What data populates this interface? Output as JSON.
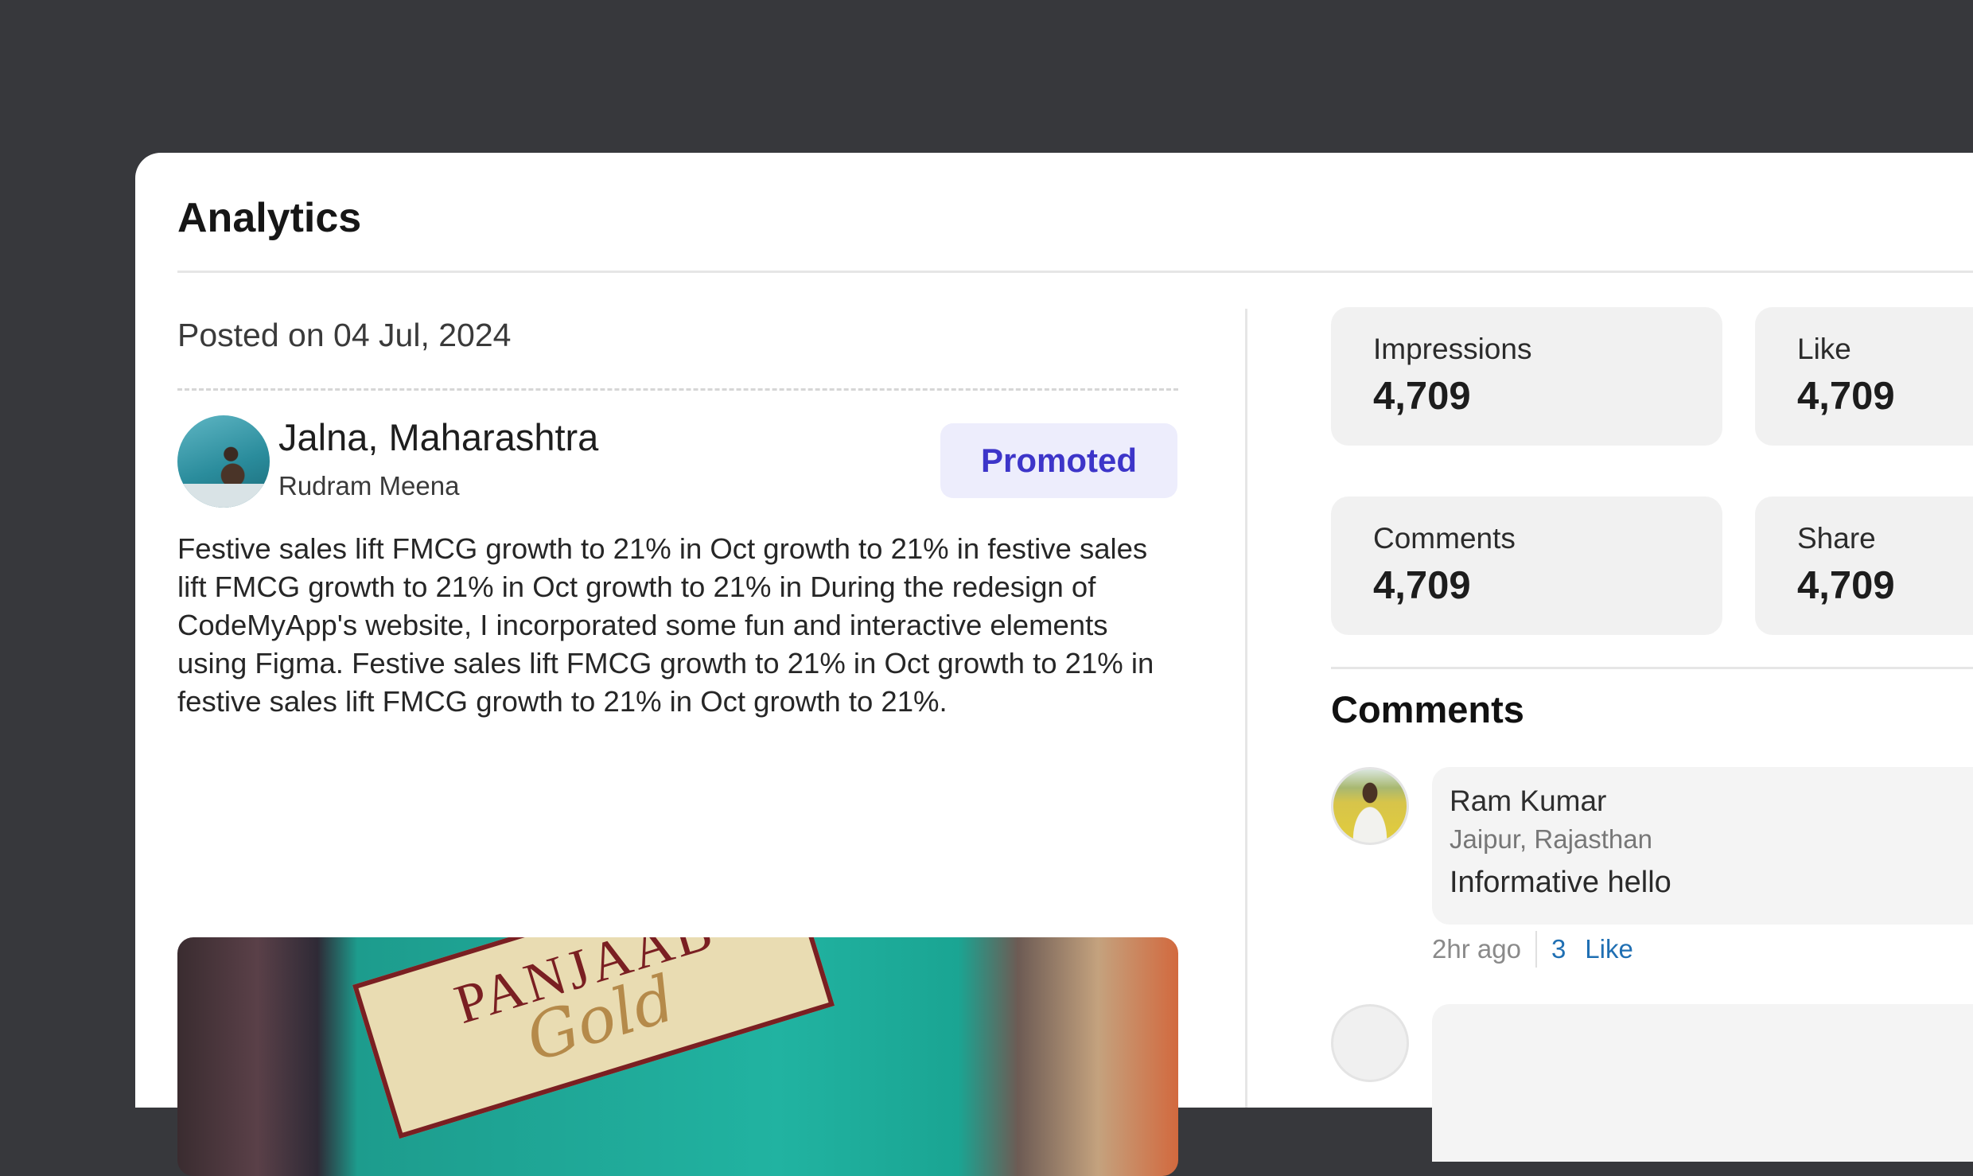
{
  "panel": {
    "title": "Analytics"
  },
  "post": {
    "posted_on": "Posted on 04 Jul, 2024",
    "author": {
      "location": "Jalna, Maharashtra",
      "name": "Rudram Meena"
    },
    "badge": "Promoted",
    "body": "Festive sales lift FMCG growth to 21% in Oct growth to 21% in festive sales lift FMCG growth to 21% in Oct growth to 21% in During the redesign of CodeMyApp's website, I incorporated some fun and interactive elements using Figma. Festive sales lift FMCG growth to 21% in Oct growth to 21% in festive sales lift FMCG growth to 21% in Oct growth to 21%.",
    "image": {
      "brand_text": "PANJAAB",
      "brand_sub": "Gold"
    }
  },
  "stats": [
    {
      "label": "Impressions",
      "value": "4,709"
    },
    {
      "label": "Like",
      "value": "4,709"
    },
    {
      "label": "Comments",
      "value": "4,709"
    },
    {
      "label": "Share",
      "value": "4,709"
    }
  ],
  "comments": {
    "title": "Comments",
    "items": [
      {
        "name": "Ram Kumar",
        "location": "Jaipur, Rajasthan",
        "text": "Informative hello",
        "time": "2hr ago",
        "like_count": "3",
        "like_label": "Like"
      }
    ]
  }
}
